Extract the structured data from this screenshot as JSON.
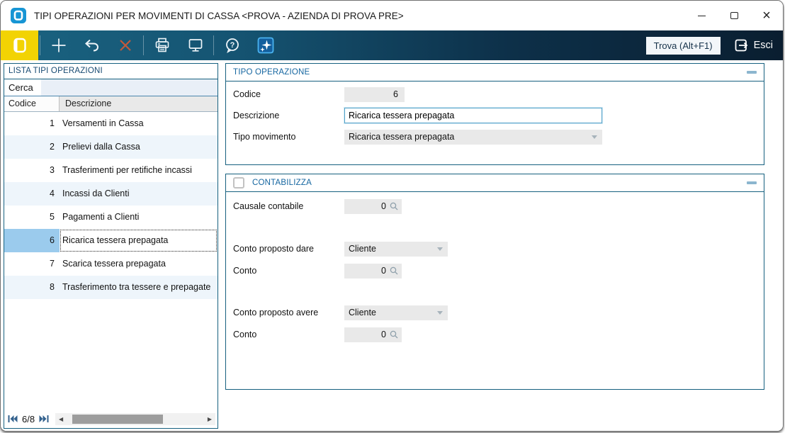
{
  "window": {
    "title": "TIPI OPERAZIONI PER MOVIMENTI DI CASSA <PROVA - AZIENDA DI PROVA PRE>"
  },
  "toolbar": {
    "trova_label": "Trova (Alt+F1)",
    "esci_label": "Esci",
    "icons": [
      "app-menu",
      "add",
      "undo",
      "delete",
      "print",
      "preview-monitor",
      "help",
      "ai-assistant",
      "exit"
    ]
  },
  "list_panel": {
    "title": "LISTA TIPI OPERAZIONI",
    "search_label": "Cerca",
    "search_value": "",
    "columns": [
      "Codice",
      "Descrizione"
    ],
    "rows": [
      {
        "codice": 1,
        "descrizione": "Versamenti in Cassa"
      },
      {
        "codice": 2,
        "descrizione": "Prelievi dalla Cassa"
      },
      {
        "codice": 3,
        "descrizione": "Trasferimenti per retifiche incassi"
      },
      {
        "codice": 4,
        "descrizione": "Incassi da Clienti"
      },
      {
        "codice": 5,
        "descrizione": "Pagamenti a Clienti"
      },
      {
        "codice": 6,
        "descrizione": "Ricarica tessera prepagata"
      },
      {
        "codice": 7,
        "descrizione": "Scarica tessera prepagata"
      },
      {
        "codice": 8,
        "descrizione": "Trasferimento tra tessere e prepagate"
      }
    ],
    "selected_codice": 6,
    "pager": "6/8"
  },
  "detail": {
    "tipo_operazione": {
      "title": "TIPO OPERAZIONE",
      "codice_label": "Codice",
      "codice_value": "6",
      "descrizione_label": "Descrizione",
      "descrizione_value": "Ricarica tessera prepagata",
      "tipo_movimento_label": "Tipo movimento",
      "tipo_movimento_value": "Ricarica tessera prepagata"
    },
    "contabilizza": {
      "title": "CONTABILIZZA",
      "checked": false,
      "causale_label": "Causale contabile",
      "causale_value": "0",
      "dare_label": "Conto proposto dare",
      "dare_value": "Cliente",
      "conto_dare_label": "Conto",
      "conto_dare_value": "0",
      "avere_label": "Conto proposto avere",
      "avere_value": "Cliente",
      "conto_avere_label": "Conto",
      "conto_avere_value": "0"
    }
  },
  "colors": {
    "toolbar_gradient_start": "#1a6381",
    "toolbar_gradient_end": "#0a1e30",
    "accent_yellow": "#f2d303",
    "panel_border_teal": "#16607f",
    "section_title_blue": "#1566a0",
    "selected_cell_blue": "#9bcbed",
    "alt_row_blue": "#eef5fb",
    "delete_x_orange": "#c4593b",
    "field_gray": "#e9e9e9"
  }
}
